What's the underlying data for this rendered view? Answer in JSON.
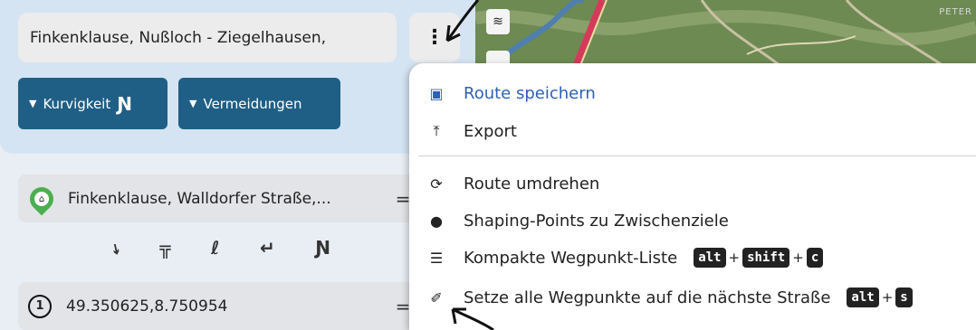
{
  "search": {
    "value": "Finkenklause, Nußloch - Ziegelhausen,"
  },
  "menu_button": {
    "label": "⋮"
  },
  "toggles": [
    {
      "label": "Kurvigkeit",
      "icon": "curvy-road-icon",
      "glyph": "Ɲ"
    },
    {
      "label": "Vermeidungen"
    }
  ],
  "waypoints": [
    {
      "text": "Finkenklause, Walldorfer Straße,...",
      "marker": "home-pin-icon"
    },
    {
      "number": "1",
      "text": "49.350625,8.750954"
    }
  ],
  "drag_handle": "=",
  "route_types": [
    "⭏",
    "╦",
    "ℓ",
    "↵",
    "Ɲ"
  ],
  "map": {
    "label": "PETER"
  },
  "dropdown": {
    "items": [
      {
        "label": "Route speichern",
        "icon": "floppy-disk-icon"
      },
      {
        "label": "Export",
        "icon": "upload-icon"
      },
      {
        "label": "Route umdrehen",
        "icon": "reverse-arrows-icon"
      },
      {
        "label": "Shaping-Points zu Zwischenziele",
        "icon": "map-marker-icon"
      },
      {
        "label": "Kompakte Wegpunkt-Liste",
        "icon": "list-icon",
        "shortcut": [
          "alt",
          "shift",
          "c"
        ]
      },
      {
        "label": "Setze alle Wegpunkte auf die nächste Straße",
        "icon": "magic-wand-icon",
        "shortcut": [
          "alt",
          "s"
        ]
      }
    ]
  },
  "colors": {
    "accent": "#1f5f85",
    "primary_item": "#2e60b8",
    "marker_green": "#4cae4f"
  }
}
